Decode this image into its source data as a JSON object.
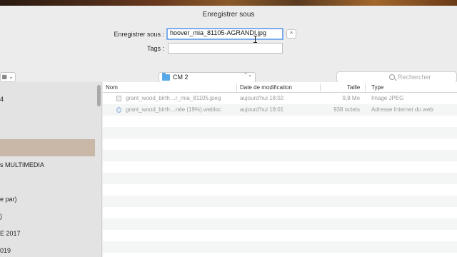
{
  "dialog": {
    "title": "Enregistrer sous"
  },
  "save_as": {
    "label": "Enregistrer sous :",
    "value": "hoover_mia_81105-AGRANDI.jpg"
  },
  "tags": {
    "label": "Tags :",
    "value": ""
  },
  "expand_button": {
    "glyph": "^"
  },
  "toolbar": {
    "view_glyph": "▦ ⌄",
    "location": "CM 2",
    "location_arrows": "⌃⌄",
    "search_placeholder": "Rechercher"
  },
  "sidebar": {
    "items": [
      {
        "label": "",
        "selected": false
      },
      {
        "label": "4",
        "selected": false
      },
      {
        "label": "",
        "selected": true
      },
      {
        "label": "s MULTIMEDIA",
        "selected": false
      },
      {
        "label": "",
        "selected": false
      },
      {
        "label": "e par)",
        "selected": false
      },
      {
        "label": ")",
        "selected": false
      },
      {
        "label": "E 2017",
        "selected": false
      },
      {
        "label": "019",
        "selected": false
      }
    ]
  },
  "file_list": {
    "columns": {
      "name": "Nom",
      "date": "Date de modification",
      "size": "Taille",
      "kind": "Type"
    },
    "rows": [
      {
        "name": "grant_wood_birth…r_mia_81105.jpeg",
        "date": "aujourd'hui 18:02",
        "size": "9,8 Mo",
        "kind": "Image JPEG",
        "icon": "image-file-icon"
      },
      {
        "name": "grant_wood_birth…née (19%).webloc",
        "date": "aujourd'hui 18:01",
        "size": "938 octets",
        "kind": "Adresse Internet du web",
        "icon": "webloc-file-icon"
      }
    ]
  }
}
